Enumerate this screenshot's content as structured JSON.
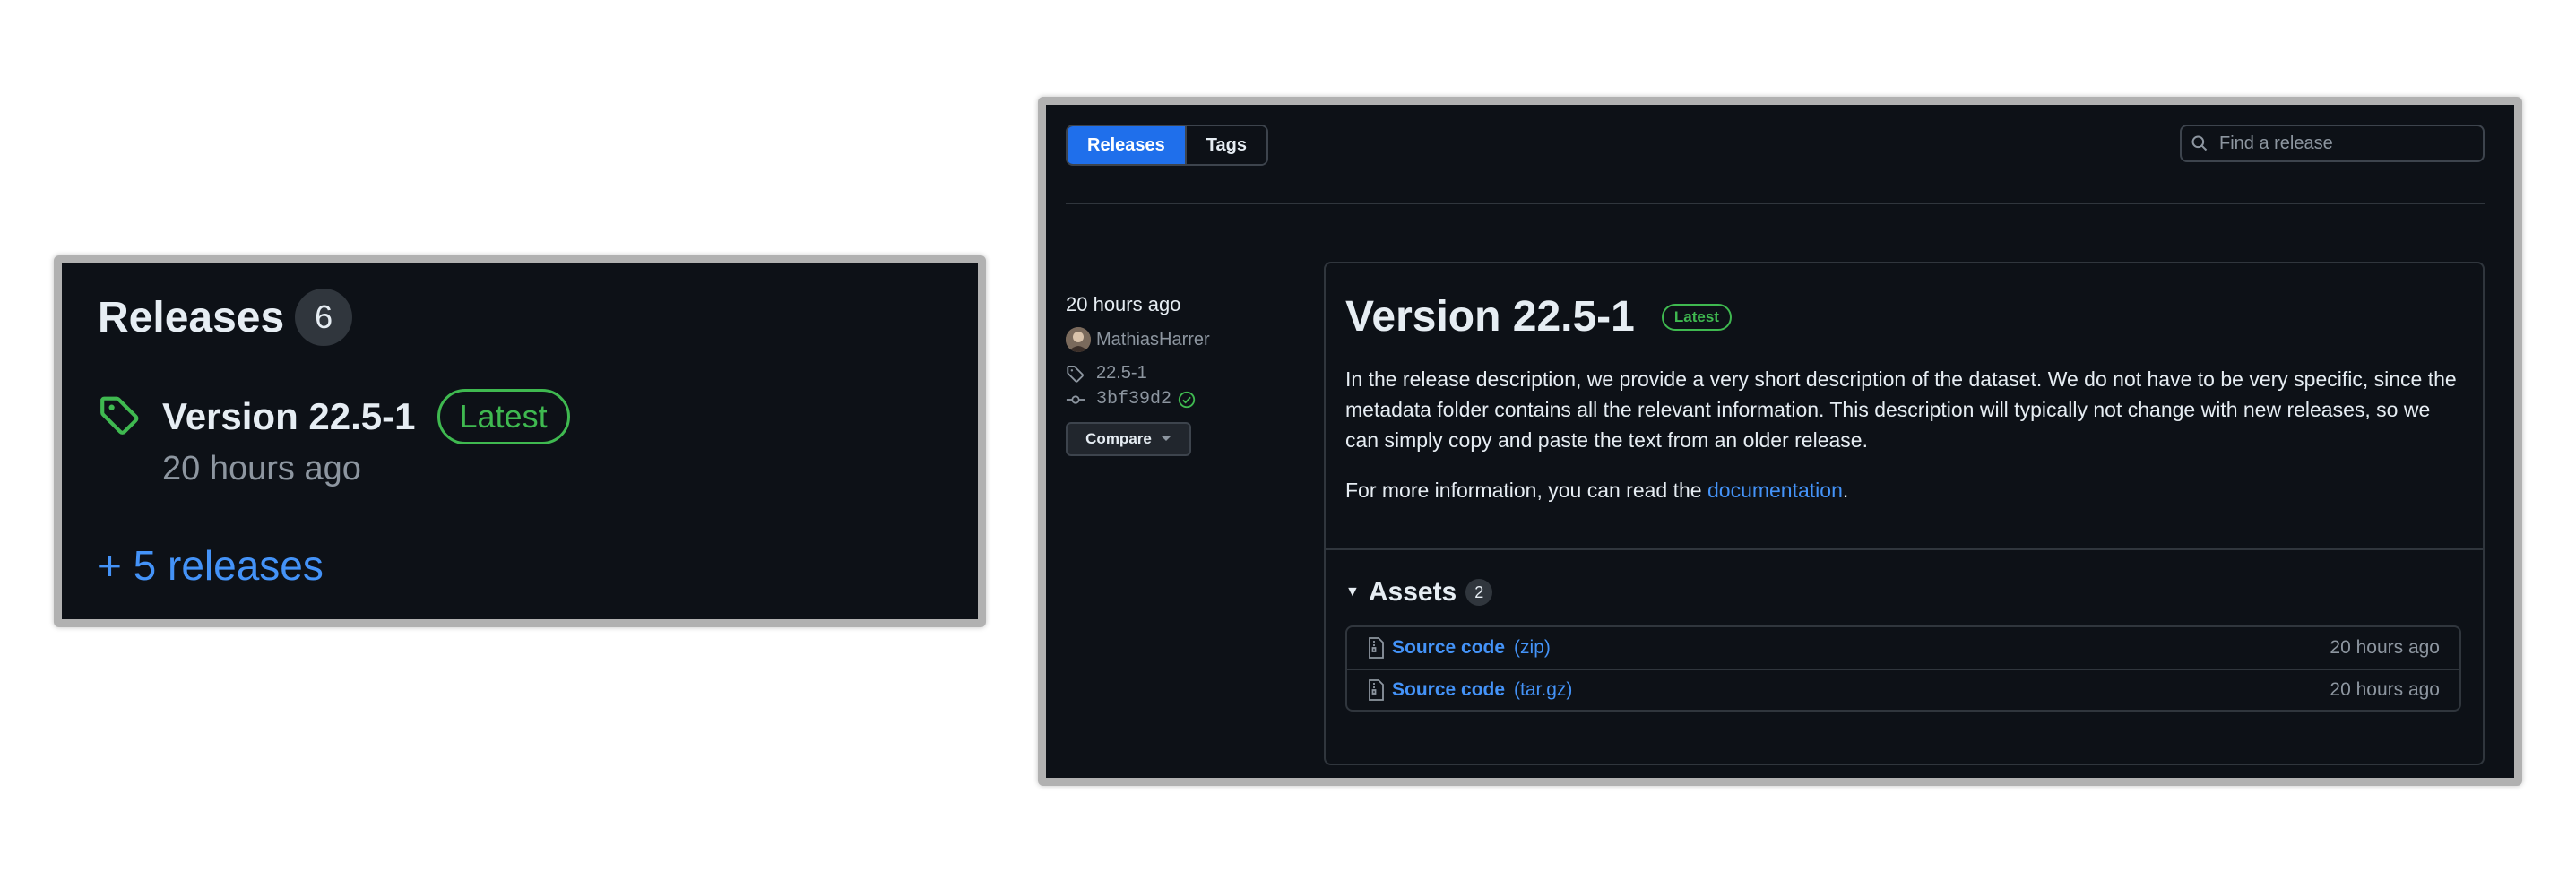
{
  "left_panel": {
    "title": "Releases",
    "count": "6",
    "release_name": "Version 22.5-1",
    "latest_badge": "Latest",
    "time": "20 hours ago",
    "more_link": "+ 5 releases"
  },
  "right_panel": {
    "tabs": [
      {
        "label": "Releases",
        "active": true
      },
      {
        "label": "Tags",
        "active": false
      }
    ],
    "search": {
      "placeholder": "Find a release"
    },
    "meta": {
      "time": "20 hours ago",
      "author": "MathiasHarrer",
      "tag": "22.5-1",
      "commit": "3bf39d2",
      "compare_label": "Compare"
    },
    "release": {
      "title": "Version 22.5-1",
      "latest_badge": "Latest",
      "description": "In the release description, we provide a very short description of the dataset. We do not have to be very specific, since the metadata folder contains all the relevant information. This description will typically not change with new releases, so we can simply copy and paste the text from an older release.",
      "more_info_prefix": "For more information, you can read the ",
      "more_info_link": "documentation",
      "more_info_suffix": "."
    },
    "assets": {
      "title": "Assets",
      "count": "2",
      "items": [
        {
          "name": "Source code",
          "ext": "(zip)",
          "time": "20 hours ago"
        },
        {
          "name": "Source code",
          "ext": "(tar.gz)",
          "time": "20 hours ago"
        }
      ]
    }
  },
  "colors": {
    "background": "#0d1117",
    "accent_blue": "#4493f8",
    "tab_active": "#1f6feb",
    "latest_green": "#3fb950",
    "muted_text": "#8d96a0"
  },
  "icons": [
    "tag-icon",
    "search-icon",
    "avatar",
    "commit-icon",
    "verified-check-icon",
    "chevron-down-icon",
    "caret-down-icon",
    "file-zip-icon"
  ]
}
